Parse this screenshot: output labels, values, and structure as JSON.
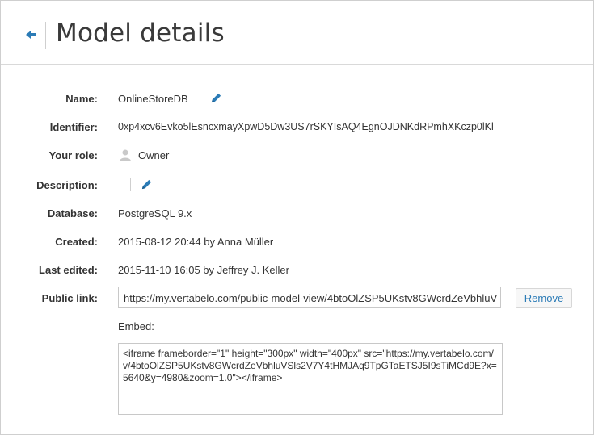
{
  "header": {
    "title": "Model details"
  },
  "fields": {
    "name": {
      "label": "Name:",
      "value": "OnlineStoreDB"
    },
    "identifier": {
      "label": "Identifier:",
      "value": "0xp4xcv6Evko5lEsncxmayXpwD5Dw3US7rSKYIsAQ4EgnOJDNKdRPmhXKczp0lKl"
    },
    "role": {
      "label": "Your role:",
      "value": "Owner"
    },
    "description": {
      "label": "Description:",
      "value": ""
    },
    "database": {
      "label": "Database:",
      "value": "PostgreSQL 9.x"
    },
    "created": {
      "label": "Created:",
      "value": "2015-08-12 20:44 by Anna Müller"
    },
    "last_edited": {
      "label": "Last edited:",
      "value": "2015-11-10 16:05 by Jeffrey J. Keller"
    },
    "public_link": {
      "label": "Public link:",
      "value": "https://my.vertabelo.com/public-model-view/4btoOlZSP5UKstv8GWcrdZeVbhluV",
      "remove_label": "Remove"
    },
    "embed": {
      "label": "Embed:",
      "value": "<iframe frameborder=\"1\" height=\"300px\" width=\"400px\" src=\"https://my.vertabelo.com/v/4btoOlZSP5UKstv8GWcrdZeVbhluVSls2V7Y4tHMJAq9TpGTaETSJ5I9sTiMCd9E?x=5640&y=4980&zoom=1.0\"></iframe>"
    }
  },
  "colors": {
    "accent": "#2b7bb6"
  },
  "icons": {
    "back": "arrow-left-icon",
    "edit": "pencil-icon",
    "role": "user-icon"
  }
}
